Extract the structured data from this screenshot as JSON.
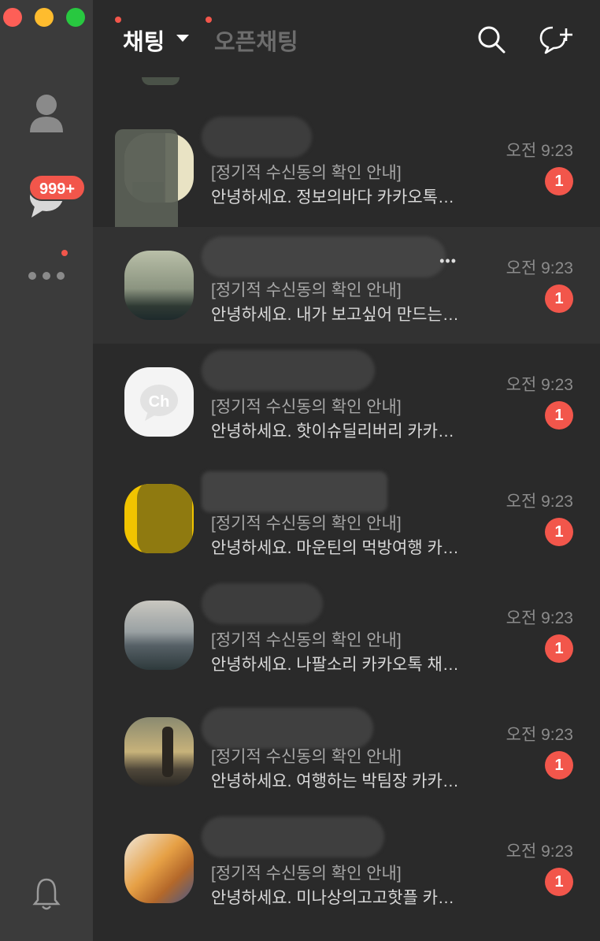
{
  "sidebar": {
    "chat_badge": "999+",
    "icons": [
      "person-icon",
      "chat-bubble-icon",
      "more-icon",
      "bell-icon"
    ]
  },
  "header": {
    "tab_chat": "채팅",
    "tab_openchat": "오픈채팅",
    "icons": [
      "search-icon",
      "new-chat-icon"
    ]
  },
  "chats": [
    {
      "line1": "[정기적 수신동의 확인 안내]",
      "line2": "안녕하세요. 정보의바다 카카오톡…",
      "time": "오전 9:23",
      "unread": "1"
    },
    {
      "line1": "[정기적 수신동의 확인 안내]",
      "line2": "안녕하세요. 내가 보고싶어 만드는…",
      "time": "오전 9:23",
      "unread": "1"
    },
    {
      "line1": "[정기적 수신동의 확인 안내]",
      "line2": "안녕하세요. 핫이슈딜리버리 카카…",
      "time": "오전 9:23",
      "unread": "1"
    },
    {
      "line1": "[정기적 수신동의 확인 안내]",
      "line2": "안녕하세요. 마운틴의 먹방여행 카…",
      "time": "오전 9:23",
      "unread": "1"
    },
    {
      "line1": "[정기적 수신동의 확인 안내]",
      "line2": "안녕하세요. 나팔소리 카카오톡 채…",
      "time": "오전 9:23",
      "unread": "1"
    },
    {
      "line1": "[정기적 수신동의 확인 안내]",
      "line2": "안녕하세요. 여행하는 박팀장 카카…",
      "time": "오전 9:23",
      "unread": "1"
    },
    {
      "line1": "[정기적 수신동의 확인 안내]",
      "line2": "안녕하세요. 미나상의고고핫플 카…",
      "time": "오전 9:23",
      "unread": "1"
    }
  ],
  "colors": {
    "accent_red": "#f2564b",
    "sidebar_bg": "#3b3b3b",
    "list_bg": "#2a2a2a",
    "selected_row": "#323232"
  }
}
